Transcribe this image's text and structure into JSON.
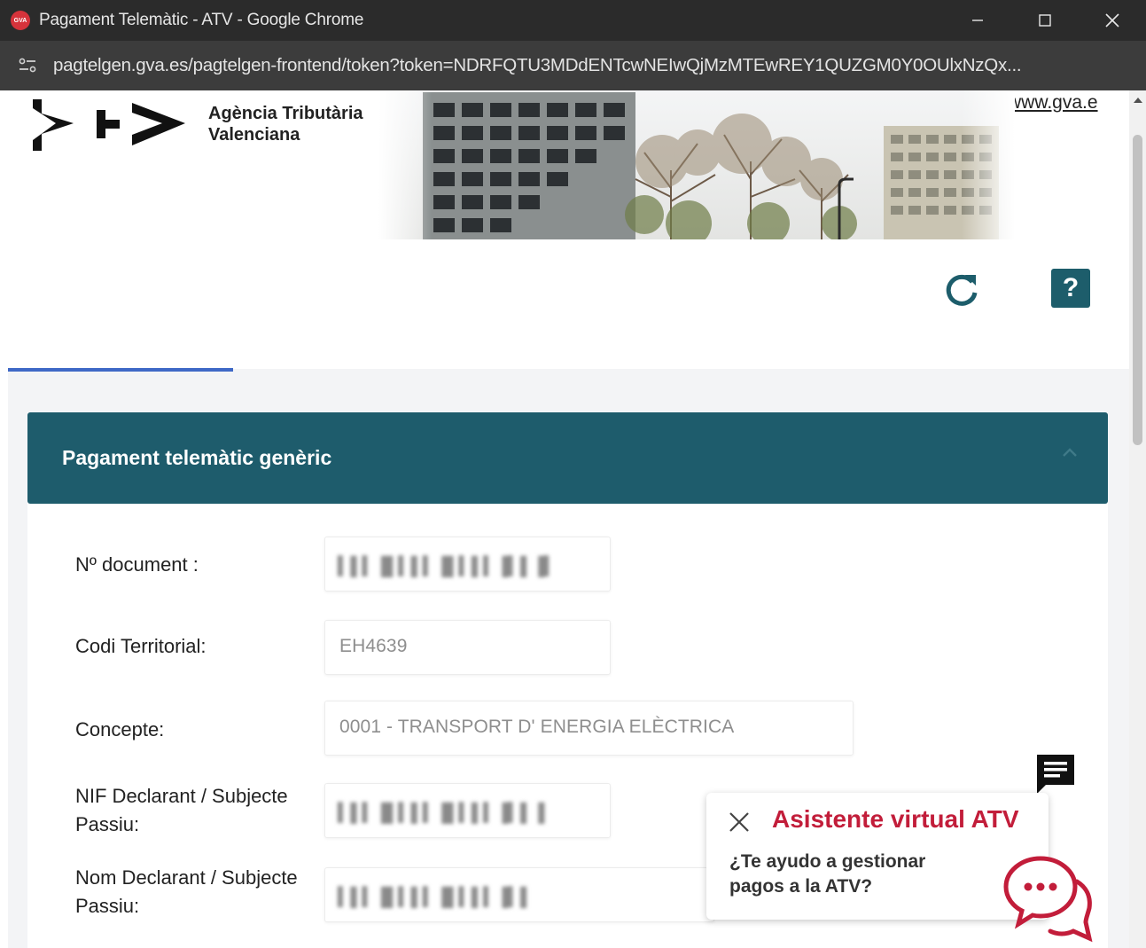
{
  "window": {
    "title": "Pagament Telemàtic - ATV - Google Chrome",
    "favicon_text": "GVA"
  },
  "address": {
    "url": "pagtelgen.gva.es/pagtelgen-frontend/token?token=NDRFQTU3MDdENTcwNEIwQjMzMTEwREY1QUZGM0Y0OUlxNzQx..."
  },
  "header": {
    "brand_line1": "Agència Tributària",
    "brand_line2": "Valenciana",
    "link": "www.gva.e"
  },
  "toolbar": {
    "help_label": "?"
  },
  "panel": {
    "title": "Pagament telemàtic genèric",
    "fields": [
      {
        "label": "Nº document :",
        "value": "",
        "blurred": true
      },
      {
        "label": "Codi Territorial:",
        "value": "EH4639"
      },
      {
        "label": "Concepte:",
        "value": "0001 - TRANSPORT D' ENERGIA ELÈCTRICA"
      },
      {
        "label_line1": "NIF Declarant / Subjecte",
        "label_line2": "Passiu:",
        "value": "",
        "blurred": true
      },
      {
        "label_line1": "Nom Declarant / Subjecte",
        "label_line2": "Passiu:",
        "value": "",
        "blurred": true
      }
    ]
  },
  "chat": {
    "title": "Asistente virtual ATV",
    "line1": "¿Te ayudo a gestionar",
    "line2": "pagos a la ATV?"
  },
  "colors": {
    "panel_header": "#1e5c6c",
    "accent_tab": "#3e68c6",
    "chat_red": "#c21d3a"
  }
}
